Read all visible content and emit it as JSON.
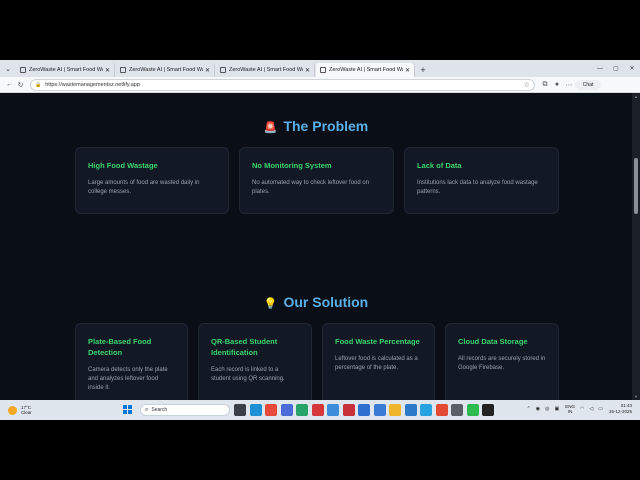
{
  "browser": {
    "tabs": [
      {
        "title": "ZeroWaste AI | Smart Food Waste",
        "active": false
      },
      {
        "title": "ZeroWaste AI | Smart Food Waste",
        "active": false
      },
      {
        "title": "ZeroWaste AI | Smart Food Waste",
        "active": false
      },
      {
        "title": "ZeroWaste AI | Smart Food Waste",
        "active": true
      }
    ],
    "url": "https://wastemanagementsz.netlify.app",
    "chat_label": "Chat"
  },
  "problem": {
    "emoji": "🚨",
    "title": "The Problem",
    "cards": [
      {
        "title": "High Food Wastage",
        "text": "Large amounts of food are wasted daily in college messes."
      },
      {
        "title": "No Monitoring System",
        "text": "No automated way to check leftover food on plates."
      },
      {
        "title": "Lack of Data",
        "text": "Institutions lack data to analyze food wastage patterns."
      }
    ]
  },
  "solution": {
    "emoji": "💡",
    "title": "Our Solution",
    "cards": [
      {
        "title": "Plate-Based Food Detection",
        "text": "Camera detects only the plate and analyzes leftover food inside it."
      },
      {
        "title": "QR-Based Student Identification",
        "text": "Each record is linked to a student using QR scanning."
      },
      {
        "title": "Food Waste Percentage",
        "text": "Leftover food is calculated as a percentage of the plate."
      },
      {
        "title": "Cloud Data Storage",
        "text": "All records are securely stored in Google Firebase."
      }
    ]
  },
  "taskbar": {
    "weather_temp": "17°C",
    "weather_desc": "Clear",
    "search_placeholder": "Search",
    "lang_top": "ENG",
    "lang_bottom": "IN",
    "time": "01:43",
    "date": "26-12-2025"
  },
  "colors": {
    "accent_title": "#5ab0e6",
    "accent_card_title": "#3bd56e",
    "page_bg": "#0a0e17",
    "card_bg": "#121824"
  }
}
